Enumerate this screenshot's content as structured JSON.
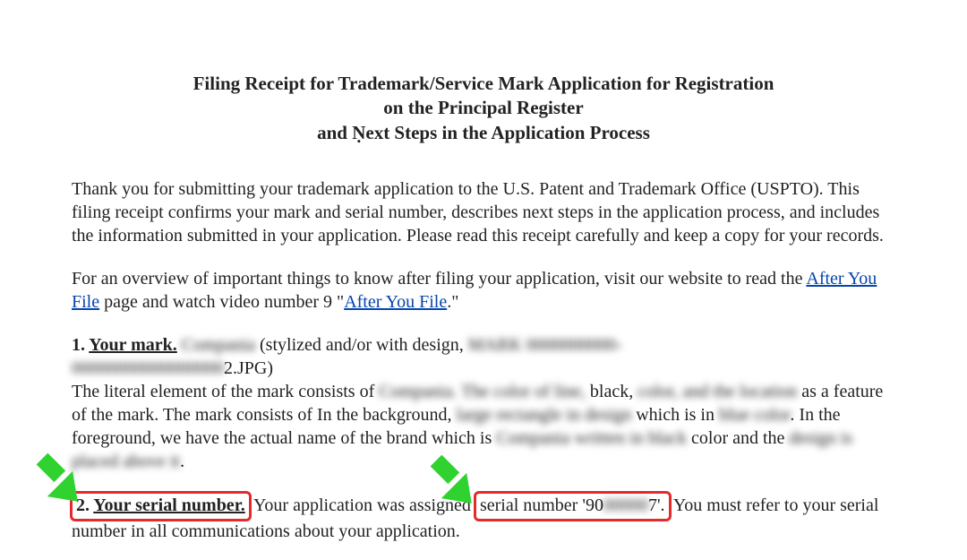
{
  "title": {
    "line1": "Filing Receipt for Trademark/Service Mark Application for Registration",
    "line2": "on the Principal Register",
    "line3": "and Ṇext Steps in the Application Process"
  },
  "para1": "Thank you for submitting your trademark application to the U.S. Patent and Trademark Office (USPTO). This filing receipt confirms your mark and serial number, describes next steps in the application process, and includes the information submitted in your application. Please read this receipt carefully and keep a copy for your records.",
  "para2_pre": "For an overview of important things to know after filing your application, visit our website to read the ",
  "link1": "After You File",
  "para2_mid": " page and watch video number 9 \"",
  "link2": "After You File",
  "para2_post": ".\"",
  "section1": {
    "num": "1. ",
    "heading": "Your mark.",
    "sp": " ",
    "r1": "Compania",
    "r2": " (stylized and/or with design, ",
    "r3": "MARK 0000000000-",
    "r4": "00000000000000000",
    "r5": "2.JPG)",
    "d1": "The literal element of the mark consists of ",
    "d1r": "Compania. The color of line,",
    "d2": " black, ",
    "d2r": "color, and the location",
    "d3": " as a feature of the mark. The mark consists of In the background, ",
    "d3r": "large rectangle in design",
    "d4": " which is in ",
    "d4r": "blue color",
    "d5": ". In the foreground, we have the actual name of the brand which is ",
    "d5r": "Compania written in black",
    "d6": " color and the ",
    "d6r": "design is placed above it",
    "d7": "."
  },
  "section2": {
    "num": "2. ",
    "heading": "Your serial number.",
    "t1": " Your application was assigned ",
    "boxed_pre": "serial number '90",
    "boxed_blur": "00000",
    "boxed_post": "7'.",
    "t2": " You must refer to your serial number in all communications about your application."
  }
}
